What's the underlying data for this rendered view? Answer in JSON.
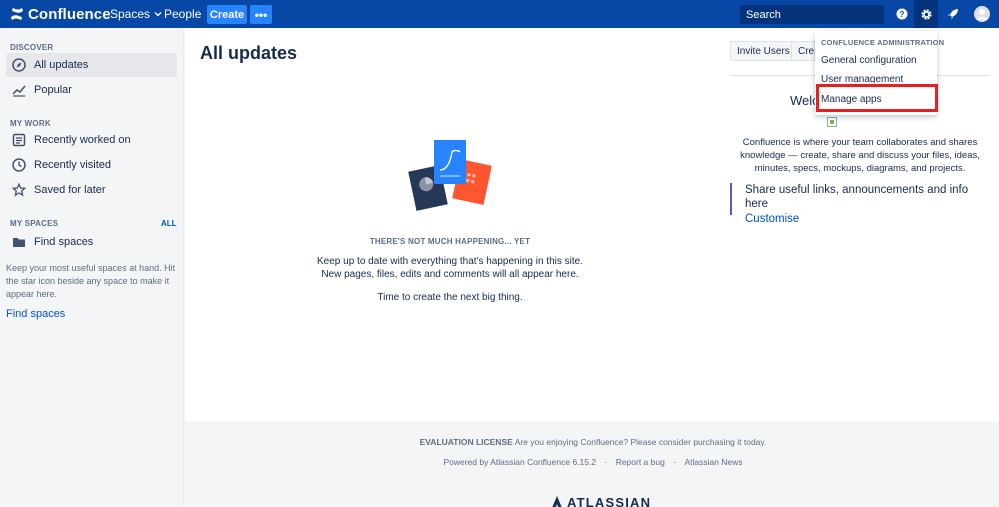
{
  "header": {
    "brand": "Confluence",
    "nav_spaces": "Spaces",
    "nav_people": "People",
    "create": "Create",
    "more": "•••",
    "search_placeholder": "Search"
  },
  "sidebar": {
    "discover_title": "DISCOVER",
    "discover_items": [
      "All updates",
      "Popular"
    ],
    "mywork_title": "MY WORK",
    "mywork_items": [
      "Recently worked on",
      "Recently visited",
      "Saved for later"
    ],
    "myspaces_title": "MY SPACES",
    "myspaces_all": "ALL",
    "find_spaces_item": "Find spaces",
    "help_text": "Keep your most useful spaces at hand. Hit the star icon beside any space to make it appear here.",
    "find_spaces_link": "Find spaces"
  },
  "main": {
    "title": "All updates",
    "empty_heading": "THERE'S NOT MUCH HAPPENING... YET",
    "empty_text": "Keep up to date with everything that's happening in this site. New pages, files, edits and comments will all appear here.",
    "empty_cta": "Time to create the next big thing."
  },
  "right_panel": {
    "invite_users": "Invite Users",
    "create_space_partial": "Crea",
    "welcome_partial": "Welc",
    "welcome_text": "Confluence is where your team collaborates and shares knowledge — create, share and discuss your files, ideas, minutes, specs, mockups, diagrams, and projects.",
    "share_text": "Share useful links, announcements and info here",
    "customise": "Customise"
  },
  "admin_menu": {
    "heading": "CONFLUENCE ADMINISTRATION",
    "items": [
      "General configuration",
      "User management",
      "Manage apps"
    ]
  },
  "footer": {
    "license_label": "EVALUATION LICENSE",
    "license_text": "Are you enjoying Confluence? Please consider purchasing it today.",
    "powered_by": "Powered by Atlassian Confluence 6.15.2",
    "sep": "·",
    "report_bug": "Report a bug",
    "news": "Atlassian News",
    "logo_text": "ATLASSIAN"
  },
  "colors": {
    "header_bg": "#0747a6",
    "primary_button": "#2684ff",
    "link": "#0052cc",
    "highlight_border": "#e5201e",
    "share_accent": "#6554c0"
  }
}
